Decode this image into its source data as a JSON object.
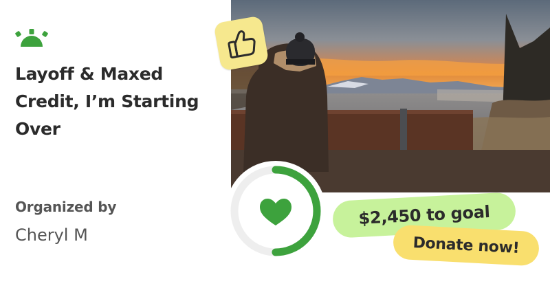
{
  "campaign": {
    "title": "Layoff & Maxed Credit, I’m Starting Over",
    "organizer_label": "Organized by",
    "organizer_name": "Cheryl M"
  },
  "fundraising": {
    "goal_text": "$2,450 to goal",
    "donate_label": "Donate now!",
    "progress_fraction": 0.5
  },
  "icons": {
    "logo": "sunrise-logo-icon",
    "badge": "thumbs-up-icon",
    "progress_center": "heart-icon"
  },
  "colors": {
    "brand_green": "#3da23d",
    "goal_pill": "#c7f29b",
    "donate_pill": "#f9df6e",
    "badge": "#f6e88e",
    "text_dark": "#2b2b2b",
    "text_muted": "#555555"
  }
}
